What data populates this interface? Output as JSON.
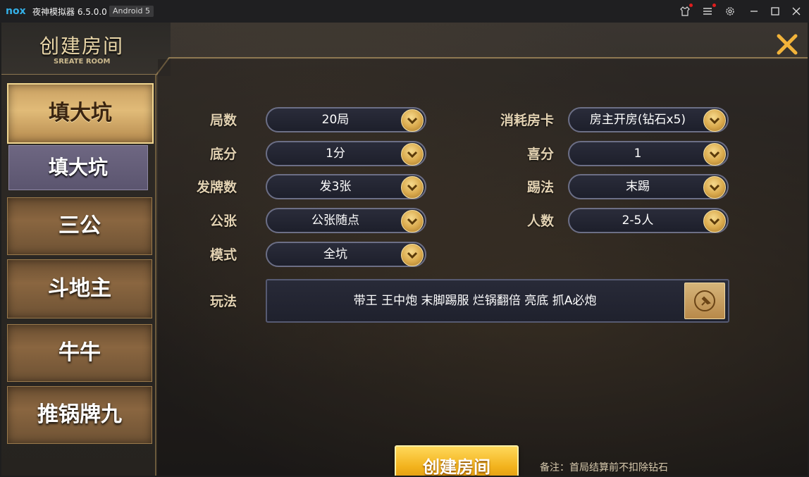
{
  "window": {
    "app_title": "夜神模拟器 6.5.0.0",
    "android_badge": "Android 5",
    "icons": [
      "shirt-icon",
      "menu-icon",
      "gear-icon",
      "minimize-icon",
      "maximize-icon",
      "close-icon"
    ]
  },
  "header": {
    "title": "创建房间",
    "subtitle": "SREATE ROOM"
  },
  "sidebar": {
    "active_game": "填大坑",
    "sub_item": "填大坑",
    "games": [
      "三公",
      "斗地主",
      "牛牛",
      "推锅牌九"
    ]
  },
  "form": {
    "left": [
      {
        "label": "局数",
        "value": "20局"
      },
      {
        "label": "底分",
        "value": "1分"
      },
      {
        "label": "发牌数",
        "value": "发3张"
      },
      {
        "label": "公张",
        "value": "公张随点"
      },
      {
        "label": "模式",
        "value": "全坑"
      }
    ],
    "right": [
      {
        "label": "消耗房卡",
        "value": "房主开房(钻石x5)"
      },
      {
        "label": "喜分",
        "value": "1"
      },
      {
        "label": "踢法",
        "value": "末踢"
      },
      {
        "label": "人数",
        "value": "2-5人"
      }
    ],
    "play_label": "玩法",
    "play_value": "带王 王中炮 末脚踢服 烂锅翻倍 亮底 抓A必炮"
  },
  "footer": {
    "create_button": "创建房间",
    "note": "备注：首局结算前不扣除钻石"
  },
  "colors": {
    "gold_accent": "#e8b84e",
    "label_text": "#e3d2b2"
  }
}
